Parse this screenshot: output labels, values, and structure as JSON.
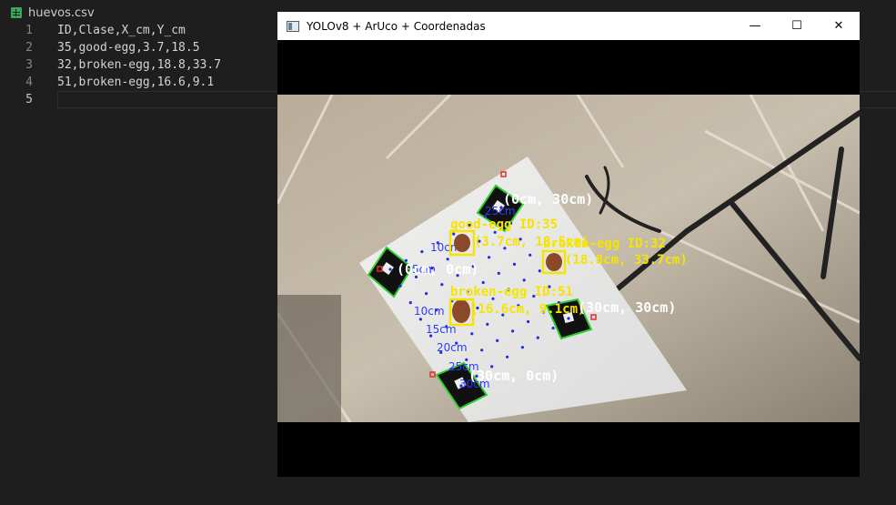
{
  "editor": {
    "tab_label": "huevos.csv",
    "lines": [
      {
        "num": "1",
        "text": "ID,Clase,X_cm,Y_cm"
      },
      {
        "num": "2",
        "text": "35,good-egg,3.7,18.5"
      },
      {
        "num": "3",
        "text": "32,broken-egg,18.8,33.7"
      },
      {
        "num": "4",
        "text": "51,broken-egg,16.6,9.1"
      },
      {
        "num": "5",
        "text": ""
      }
    ]
  },
  "window": {
    "title": "YOLOv8 + ArUco + Coordenadas",
    "minimize_glyph": "—",
    "maximize_glyph": "☐",
    "close_glyph": "✕"
  },
  "camera": {
    "corners": [
      {
        "id": "c00",
        "label": "(0cm, 0cm)"
      },
      {
        "id": "c30_0",
        "label": "(30cm, 0cm)"
      },
      {
        "id": "c0_30",
        "label": "(0cm, 30cm)"
      },
      {
        "id": "c30_30",
        "label": "(30cm, 30cm)"
      }
    ],
    "detections": [
      {
        "label": "good-egg ID:35",
        "coords": "(3.7cm, 18.5cm)"
      },
      {
        "label": "broken-egg ID:32",
        "coords": "(18.8cm, 33.7cm)"
      },
      {
        "label": "broken-egg ID:51",
        "coords": "(16.6cm, 9.1cm)"
      }
    ],
    "grid_ticks_left": [
      "5cm",
      "10cm",
      "15cm",
      "20cm",
      "25cm",
      "30cm"
    ],
    "grid_ticks_top": [
      "5cm",
      "10cm",
      "15cm",
      "20cm",
      "25cm"
    ],
    "colors": {
      "detection_box": "#f5e400",
      "corner_label": "#ffffff",
      "grid_dot": "#1e30e0",
      "grid_text": "#2a3cff",
      "marker_outline": "#2ecf2e"
    }
  }
}
